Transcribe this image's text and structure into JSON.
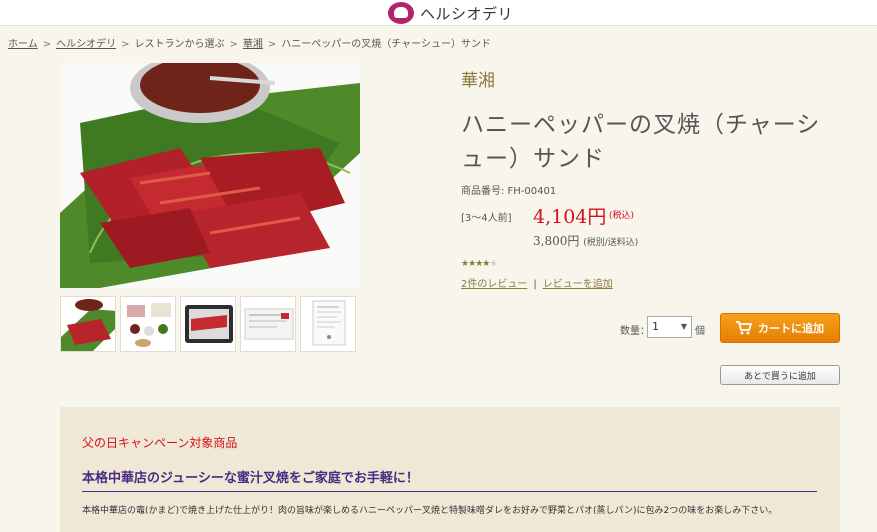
{
  "header": {
    "logo_text": "ヘルシオデリ"
  },
  "breadcrumb": [
    "ホーム",
    "ヘルシオデリ",
    "レストランから選ぶ",
    "華湘",
    "ハニーペッパーの叉焼（チャーシュー）サンド"
  ],
  "product": {
    "restaurant": "華湘",
    "title": "ハニーペッパーの叉焼（チャーシュー）サンド",
    "code": "商品番号: FH-00401",
    "serving": "[3〜4人前]",
    "price": "4,104円",
    "price_note": "(税込)",
    "price_excl": "3,800円",
    "price_excl_note": "(税別/送料込)",
    "rating": 3.5,
    "reviews_link": "2件のレビュー",
    "add_review_link": "レビューを追加"
  },
  "purchase": {
    "qty_label": "数量：",
    "qty_value": "1",
    "qty_unit": "個",
    "cart_button": "カートに追加",
    "later_button": "あとで買うに追加"
  },
  "promo": {
    "title": "父の日キャンペーン対象商品",
    "subtitle": "本格中華店のジューシーな蜜汁叉焼をご家庭でお手軽に！",
    "description": "本格中華店の竈(かまど)で焼き上げた仕上がり！肉の旨味が楽しめるハニーペッパー叉焼と特製味噌ダレをお好みで野菜とパオ(蒸しパン)に包み2つの味をお楽しみ下さい。"
  },
  "colors": {
    "accent": "#8a7b3e",
    "price": "#d4111b",
    "cart": "#f39512",
    "brand": "#b0246e",
    "promo_heading": "#4a2a82"
  }
}
